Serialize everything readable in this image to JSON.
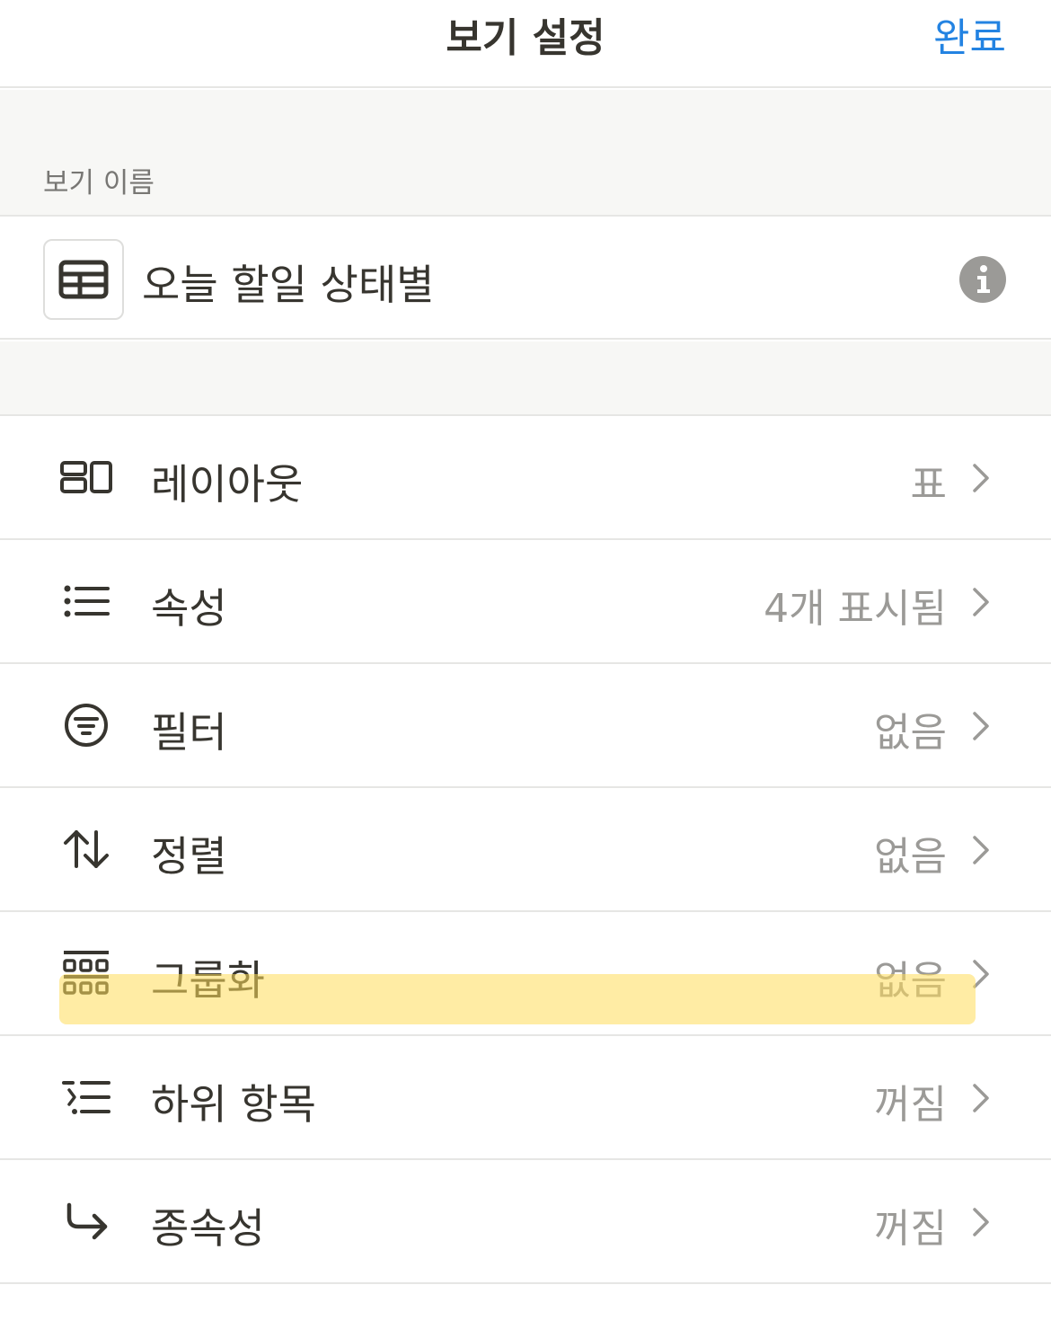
{
  "header": {
    "title": "보기 설정",
    "done_label": "완료"
  },
  "view_name_section": {
    "label": "보기 이름",
    "name": "오늘 할일 상태별",
    "icon": "table-icon",
    "info_icon": "info-icon"
  },
  "settings": {
    "rows": [
      {
        "label": "레이아웃",
        "value": "표",
        "icon": "layout-icon"
      },
      {
        "label": "속성",
        "value": "4개 표시됨",
        "icon": "list-icon"
      },
      {
        "label": "필터",
        "value": "없음",
        "icon": "filter-icon"
      },
      {
        "label": "정렬",
        "value": "없음",
        "icon": "sort-icon"
      },
      {
        "label": "그룹화",
        "value": "없음",
        "icon": "group-icon"
      },
      {
        "label": "하위 항목",
        "value": "꺼짐",
        "icon": "sub-items-icon"
      },
      {
        "label": "종속성",
        "value": "꺼짐",
        "icon": "dependency-icon"
      }
    ]
  },
  "colors": {
    "accent": "#2383e2",
    "text": "#37352f",
    "muted": "#9b9a97",
    "highlight": "#ffdd5a"
  }
}
